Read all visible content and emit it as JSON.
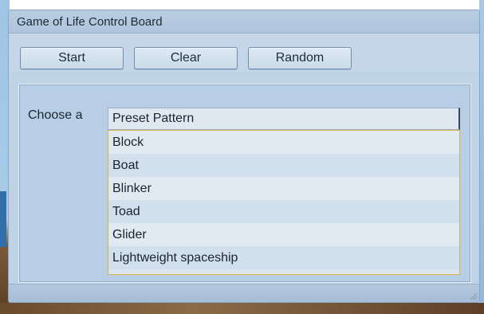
{
  "window": {
    "title": "Game of Life Control Board"
  },
  "toolbar": {
    "start_label": "Start",
    "clear_label": "Clear",
    "random_label": "Random"
  },
  "preset": {
    "label": "Choose a",
    "selected": "Preset Pattern",
    "options": [
      "Block",
      "Boat",
      "Blinker",
      "Toad",
      "Glider",
      "Lightweight spaceship"
    ]
  },
  "colors": {
    "window_bg": "#bfd3e7",
    "dropdown_border": "#d6b24a"
  }
}
